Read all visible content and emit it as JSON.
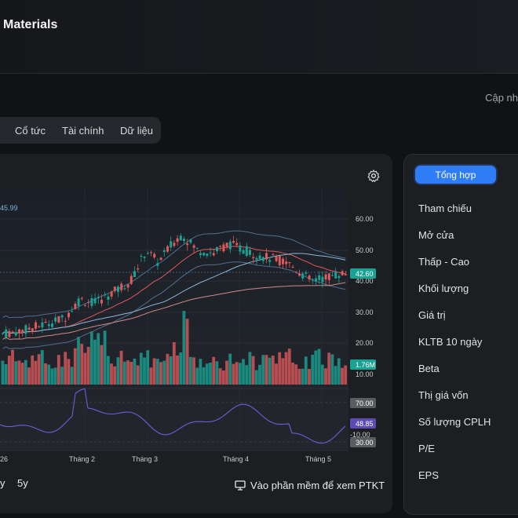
{
  "header": {
    "title": "Materials"
  },
  "update_text": "Cập nh",
  "tabs": [
    {
      "label": "Cổ tức"
    },
    {
      "label": "Tài chính"
    },
    {
      "label": "Dữ liệu"
    }
  ],
  "chart": {
    "top_left_value": "45.99",
    "price_ticks": [
      "60.00",
      "50.00",
      "40.00",
      "30.00",
      "20.00",
      "10.00"
    ],
    "current_price": "42.60",
    "volume_label": "1.76M",
    "rsi_ticks": [
      "70.00",
      "30.00"
    ],
    "rsi_value": "48.85",
    "rsi_neg_tick": "-10.00",
    "x_ticks": [
      "26",
      "Tháng 2",
      "Tháng 3",
      "Tháng 4",
      "Tháng 5"
    ],
    "colors": {
      "up": "#1aa394",
      "down": "#e0595c",
      "price_badge": "#1aa394",
      "rsi_badge": "#5b4bb3",
      "rsi_line": "#6b5fd6"
    }
  },
  "ranges": [
    {
      "label": "y"
    },
    {
      "label": "5y"
    }
  ],
  "ptkt_label": "Vào phần mềm để xem PTKT",
  "sidebar": {
    "active_tab": "Tổng hợp",
    "items": [
      {
        "label": "Tham chiếu"
      },
      {
        "label": "Mở cửa"
      },
      {
        "label": "Thấp - Cao"
      },
      {
        "label": "Khối lượng"
      },
      {
        "label": "Giá trị"
      },
      {
        "label": "KLTB 10 ngày"
      },
      {
        "label": "Beta"
      },
      {
        "label": "Thị giá vốn"
      },
      {
        "label": "Số lượng CPLH"
      },
      {
        "label": "P/E"
      },
      {
        "label": "EPS"
      }
    ]
  }
}
